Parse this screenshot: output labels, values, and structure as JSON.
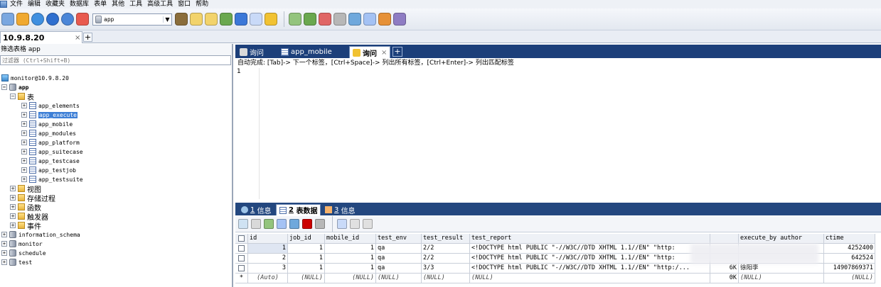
{
  "menu": {
    "items": [
      "文件",
      "编辑",
      "收藏夹",
      "数据库",
      "表单",
      "其他",
      "工具",
      "高级工具",
      "窗口",
      "帮助"
    ]
  },
  "toolbar": {
    "database_select": "app",
    "left_icon_colors": [
      "#7aa7e0",
      "#f0a930",
      "#3f8fe0",
      "#2f6fcf",
      "#4b86d8",
      "#e85a4f"
    ],
    "right_icon_colors": [
      "#8a6d3b",
      "#f2d36b",
      "#f2d36b",
      "#6aa84f",
      "#3c78d8",
      "#c9daf8",
      "#f1c232",
      "#93c47d",
      "#6aa84f",
      "#e06666",
      "#b7b7b7",
      "#6fa8dc",
      "#a4c2f4",
      "#e69138",
      "#8e7cc3"
    ]
  },
  "connection": {
    "tab_label": "10.9.8.20",
    "close_glyph": "×",
    "add_glyph": "+"
  },
  "left_panel": {
    "filter_label": "筛选表格 app",
    "filter_placeholder": "过滤器 (Ctrl+Shift+B)"
  },
  "tree": {
    "server": "monitor@10.9.8.20",
    "app_db": "app",
    "tables_folder": "表",
    "tables": [
      "app_elements",
      "app_execute",
      "app_mobile",
      "app_modules",
      "app_platform",
      "app_suitecase",
      "app_testcase",
      "app_testjob",
      "app_testsuite"
    ],
    "selected_table": "app_execute",
    "folders": [
      "视图",
      "存储过程",
      "函数",
      "触发器",
      "事件"
    ],
    "other_dbs": [
      "information_schema",
      "monitor",
      "schedule",
      "test"
    ]
  },
  "query_tabs": {
    "tab1": "询问",
    "tab2": "app_mobile",
    "tab3": "询问",
    "close_glyph": "×",
    "add_glyph": "+"
  },
  "editor": {
    "hint": "自动完成: [Tab]-> 下一个标签，[Ctrl+Space]-> 列出所有标签，[Ctrl+Enter]-> 列出匹配标签",
    "line_number": "1"
  },
  "result_tabs": {
    "t1_num": "1",
    "t1_label": "信息",
    "t2_num": "2",
    "t2_label": "表数据",
    "t3_num": "3",
    "t3_label": "信息"
  },
  "grid": {
    "columns": [
      "id",
      "job_id",
      "mobile_id",
      "test_env",
      "test_result",
      "test_report",
      "",
      "execute_by author",
      "ctime"
    ],
    "rows": [
      [
        "1",
        "1",
        "1",
        "qa",
        "2/2",
        "<!DOCTYPE html PUBLIC \"-//W3C//DTD XHTML 1.1//EN\" \"http:",
        "",
        "",
        "4252400"
      ],
      [
        "2",
        "1",
        "1",
        "qa",
        "2/2",
        "<!DOCTYPE html PUBLIC \"-//W3C//DTD XHTML 1.1//EN\" \"http:",
        "",
        "",
        "642524"
      ],
      [
        "3",
        "1",
        "1",
        "qa",
        "3/3",
        "<!DOCTYPE html PUBLIC \"-//W3C//DTD XHTML 1.1//EN\" \"http:/...",
        "6K",
        "徐阳李",
        "14907869371"
      ]
    ],
    "new_row": [
      "*",
      "(Auto)",
      "(NULL)",
      "(NULL)",
      "(NULL)",
      "(NULL)",
      "(NULL)",
      "0K",
      "(NULL)",
      "(NULL)"
    ]
  }
}
